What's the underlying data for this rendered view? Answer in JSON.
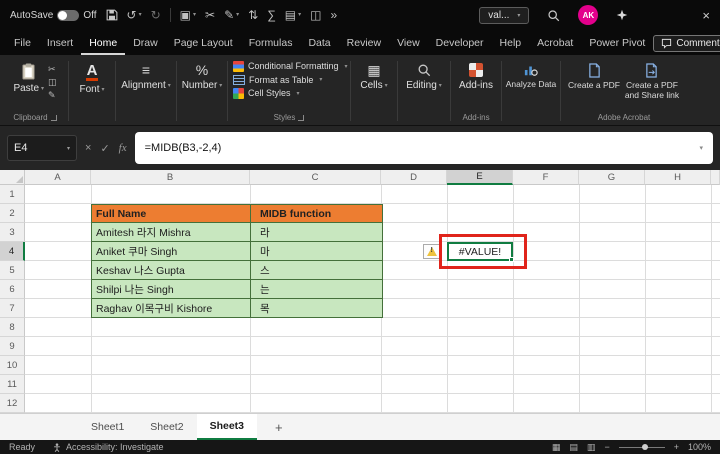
{
  "titlebar": {
    "autosave_label": "AutoSave",
    "autosave_state": "Off",
    "search_value": "val...",
    "avatar_initials": "AK"
  },
  "icons": {
    "undo": "↺",
    "redo": "↻",
    "paste_small": "▣",
    "cut": "✂",
    "format_painter": "✎",
    "sort": "⇅",
    "autosum": "∑",
    "fill_color": "▤",
    "merge_center": "◫",
    "overflow": "»",
    "close": "×",
    "cancel": "×",
    "check": "✓",
    "fx": "fx",
    "font_letter": "A",
    "align": "≡",
    "percent": "%",
    "cells": "▦",
    "view_normal": "▦",
    "view_page_layout": "▤",
    "view_page_break": "▥",
    "zoom_out": "−",
    "zoom_in": "+"
  },
  "ribbon": {
    "tabs": [
      "File",
      "Insert",
      "Home",
      "Draw",
      "Page Layout",
      "Formulas",
      "Data",
      "Review",
      "View",
      "Developer",
      "Help",
      "Acrobat",
      "Power Pivot"
    ],
    "active_tab": "Home",
    "comments_label": "Comments",
    "paste_label": "Paste",
    "clipboard_group": "Clipboard",
    "font_group": "Font",
    "alignment_group": "Alignment",
    "number_group": "Number",
    "conditional_formatting": "Conditional Formatting",
    "format_as_table": "Format as Table",
    "cell_styles": "Cell Styles",
    "styles_group": "Styles",
    "cells_group": "Cells",
    "editing_group": "Editing",
    "addins_button": "Add-ins",
    "addins_group": "Add-ins",
    "analyze_data": "Analyze Data",
    "create_pdf": "Create a PDF",
    "create_pdf_share": "Create a PDF and Share link",
    "adobe_group": "Adobe Acrobat"
  },
  "formula_bar": {
    "name_box": "E4",
    "formula": "=MIDB(B3,-2,4)"
  },
  "grid": {
    "column_headers": [
      "A",
      "B",
      "C",
      "D",
      "E",
      "F",
      "G",
      "H"
    ],
    "row_headers": [
      "1",
      "2",
      "3",
      "4",
      "5",
      "6",
      "7",
      "8",
      "9",
      "10",
      "11",
      "12"
    ],
    "selected_cell_value": "#VALUE!",
    "table_headers": [
      "Full Name",
      "MIDB function"
    ],
    "table_rows": [
      [
        "Amitesh 라지 Mishra",
        "라"
      ],
      [
        "Aniket 쿠마 Singh",
        "마"
      ],
      [
        "Keshav 나스 Gupta",
        "스"
      ],
      [
        "Shilpi 나는 Singh",
        "는"
      ],
      [
        "Raghav 이목구비 Kishore",
        "목"
      ]
    ]
  },
  "sheet_bar": {
    "tabs": [
      "Sheet1",
      "Sheet2",
      "Sheet3"
    ],
    "active_tab": "Sheet3",
    "add_sheet": "+"
  },
  "status_bar": {
    "ready": "Ready",
    "accessibility": "Accessibility: Investigate",
    "zoom": "100%"
  },
  "colors": {
    "accent_green": "#107C41",
    "table_header_bg": "#ED7D31",
    "table_row_bg": "#C8E7BF",
    "annotation_red": "#E0241B",
    "avatar_pink": "#E3008C"
  }
}
